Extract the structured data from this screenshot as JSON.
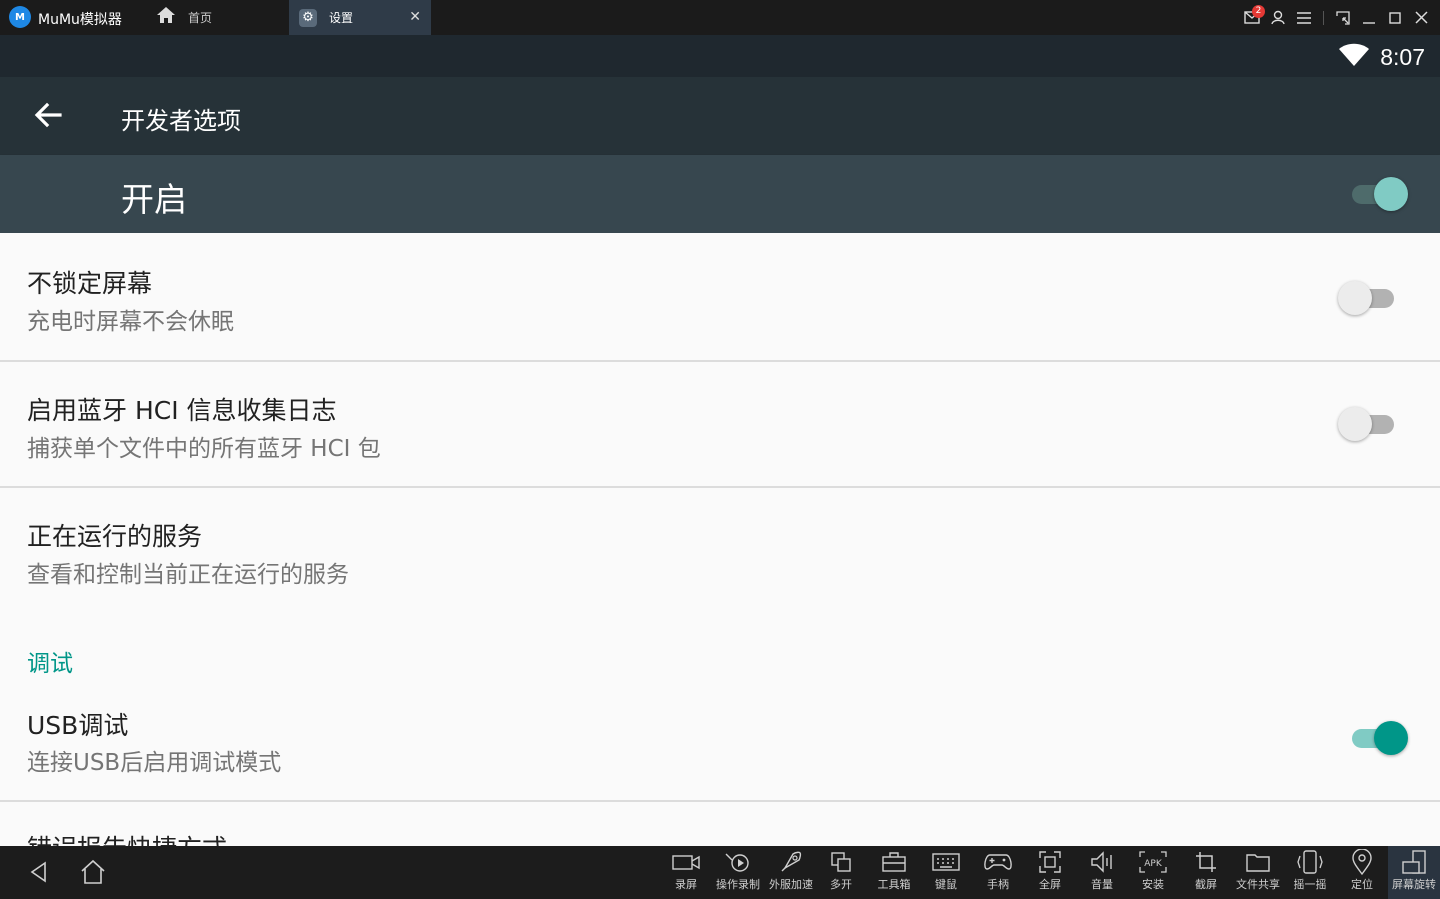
{
  "window": {
    "app_name": "MuMu模拟器",
    "logo_text": "M",
    "tabs": [
      {
        "label": "首页"
      },
      {
        "label": "设置"
      }
    ],
    "mail_badge": "2"
  },
  "status_bar": {
    "time": "8:07"
  },
  "app_bar": {
    "title": "开发者选项"
  },
  "master_switch": {
    "label": "开启",
    "on": true
  },
  "settings": [
    {
      "title": "不锁定屏幕",
      "subtitle": "充电时屏幕不会休眠",
      "toggle": false
    },
    {
      "title": "启用蓝牙 HCI 信息收集日志",
      "subtitle": "捕获单个文件中的所有蓝牙 HCI 包",
      "toggle": false
    },
    {
      "title": "正在运行的服务",
      "subtitle": "查看和控制当前正在运行的服务"
    }
  ],
  "debug_section": {
    "header": "调试",
    "items": [
      {
        "title": "USB调试",
        "subtitle": "连接USB后启用调试模式",
        "toggle": true
      },
      {
        "title": "错误报告快捷方式"
      }
    ]
  },
  "toolbar": {
    "items": [
      {
        "label": "录屏",
        "icon": "video-camera-icon"
      },
      {
        "label": "操作录制",
        "icon": "record-play-icon"
      },
      {
        "label": "外服加速",
        "icon": "rocket-icon"
      },
      {
        "label": "多开",
        "icon": "multi-window-icon"
      },
      {
        "label": "工具箱",
        "icon": "toolbox-icon"
      },
      {
        "label": "键鼠",
        "icon": "keyboard-icon"
      },
      {
        "label": "手柄",
        "icon": "gamepad-icon"
      },
      {
        "label": "全屏",
        "icon": "fullscreen-icon"
      },
      {
        "label": "音量",
        "icon": "volume-icon"
      },
      {
        "label": "安装",
        "icon": "apk-icon"
      },
      {
        "label": "截屏",
        "icon": "crop-icon"
      },
      {
        "label": "文件共享",
        "icon": "folder-icon"
      },
      {
        "label": "摇一摇",
        "icon": "shake-icon"
      },
      {
        "label": "定位",
        "icon": "location-icon"
      },
      {
        "label": "屏幕旋转",
        "icon": "rotate-icon"
      }
    ]
  },
  "colors": {
    "accent": "#009688",
    "app_bar": "#263238",
    "master_bar": "#37474f",
    "status_bar": "#1f282f",
    "title_bar": "#1b1b1b"
  }
}
